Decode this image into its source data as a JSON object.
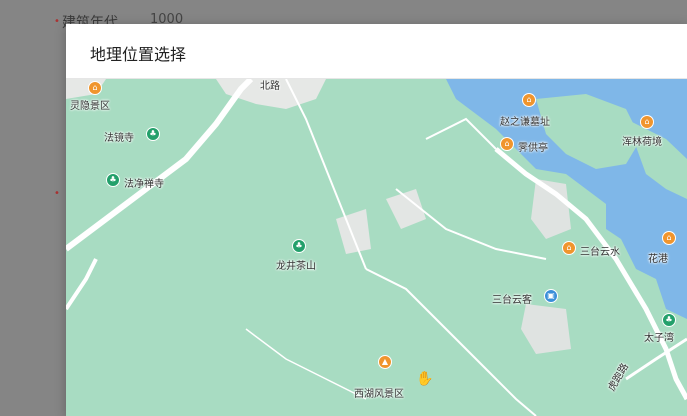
{
  "background_form": {
    "label_top": "建筑年代",
    "input_value": "1000"
  },
  "dialog": {
    "title": "地理位置选择"
  },
  "map": {
    "pois": [
      {
        "name": "灵隐景区",
        "type": "scenic"
      },
      {
        "name": "法镜寺",
        "type": "temple"
      },
      {
        "name": "法净禅寺",
        "type": "temple"
      },
      {
        "name": "赵之谦墓址",
        "type": "monument"
      },
      {
        "name": "霁供亭",
        "type": "monument"
      },
      {
        "name": "浑林荷境",
        "type": "monument"
      },
      {
        "name": "龙井茶山",
        "type": "park"
      },
      {
        "name": "三台云水",
        "type": "monument"
      },
      {
        "name": "三台云客",
        "type": "hotel"
      },
      {
        "name": "西湖风景区",
        "type": "scenic"
      },
      {
        "name": "花港",
        "type": "monument"
      },
      {
        "name": "太子湾",
        "type": "park"
      }
    ],
    "road_labels": [
      "北路",
      "虎跑路"
    ],
    "colors": {
      "land": "#a8dcc2",
      "water": "#7fb7e8",
      "urban": "#e6e8e6",
      "road": "#ffffff"
    }
  }
}
